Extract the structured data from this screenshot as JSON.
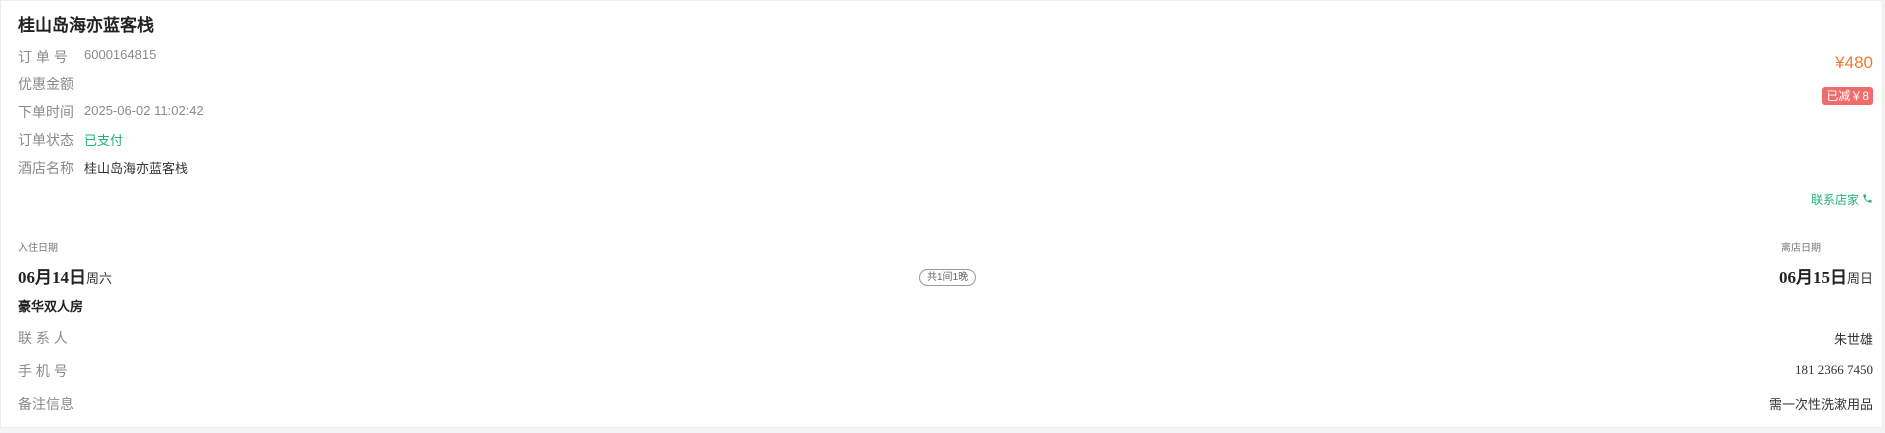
{
  "hotel_title": "桂山岛海亦蓝客栈",
  "order": {
    "number_label": "订 单 号",
    "number": "6000164815",
    "price": "¥480",
    "discount_label": "优惠金额",
    "discount_badge": "已减￥8",
    "time_label": "下单时间",
    "time": "2025-06-02 11:02:42",
    "status_label": "订单状态",
    "status": "已支付",
    "hotel_label": "酒店名称",
    "hotel_name": "桂山岛海亦蓝客栈",
    "contact_merchant": "联系店家"
  },
  "stay": {
    "checkin_label": "入住日期",
    "checkin_date": "06月14日",
    "checkin_weekday": "周六",
    "nights": "共1间1晚",
    "checkout_label": "离店日期",
    "checkout_date": "06月15日",
    "checkout_weekday": "周日",
    "room_type": "豪华双人房"
  },
  "guest": {
    "contact_label": "联 系 人",
    "contact_name": "朱世雄",
    "phone_label": "手 机 号",
    "phone": "181 2366 7450",
    "remark_label": "备注信息",
    "remark": "需一次性洗漱用品"
  },
  "colors": {
    "price": "#f27935",
    "paid_status": "#1fb37a",
    "discount_badge_bg": "#f06b6b"
  },
  "icons": {
    "contact_merchant": "phone-icon"
  }
}
